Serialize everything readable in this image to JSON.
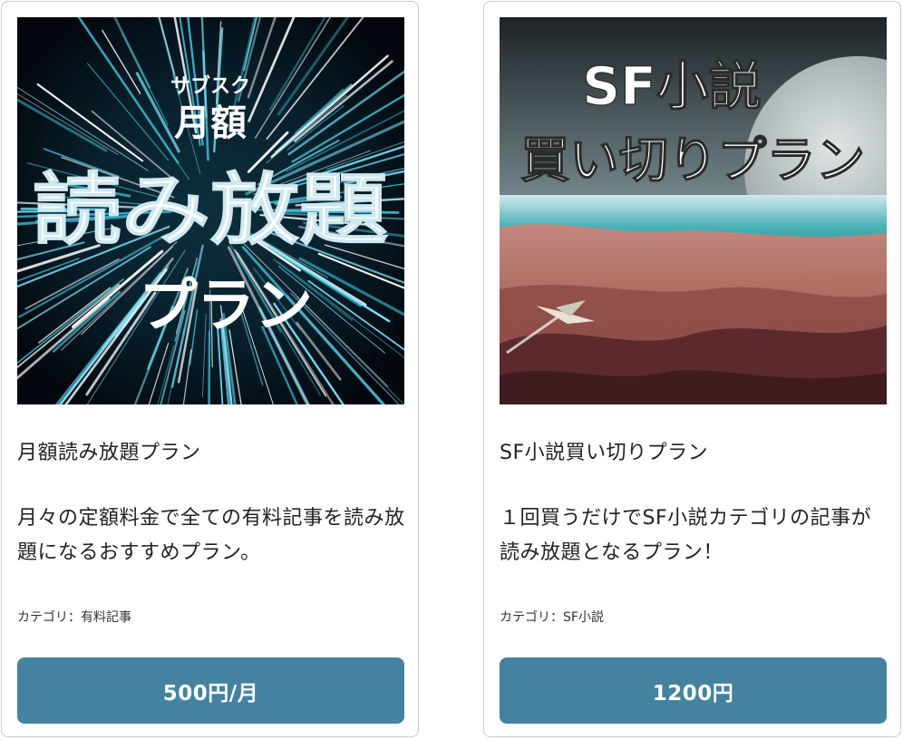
{
  "plans": [
    {
      "image": {
        "kicker": "サブスク",
        "line1": "月額",
        "line2": "読み放題",
        "line3": "プラン",
        "palette": {
          "bg": "#06131f",
          "streak_a": "#7fe6ff",
          "streak_b": "#ffffff",
          "streak_c": "#3ab0c8"
        }
      },
      "title": "月額読み放題プラン",
      "description": "月々の定額料金で全ての有料記事を読み放題になるおすすめプラン。",
      "category": "カテゴリ：有料記事",
      "price": "500円/月"
    },
    {
      "image": {
        "line1": "SF小説",
        "line2": "買い切りプラン",
        "palette": {
          "sky": "#8fa3a8",
          "sea": "#4fb3b8",
          "land": "#b8766a",
          "rock": "#5a2e2e",
          "planet": "#b9c3c5"
        }
      },
      "title": "SF小説買い切りプラン",
      "description": "１回買うだけでSF小説カテゴリの記事が読み放題となるプラン！",
      "category": "カテゴリ：SF小説",
      "price": "1200円"
    }
  ],
  "colors": {
    "button": "#4383a0",
    "border": "#c9c9c9"
  }
}
